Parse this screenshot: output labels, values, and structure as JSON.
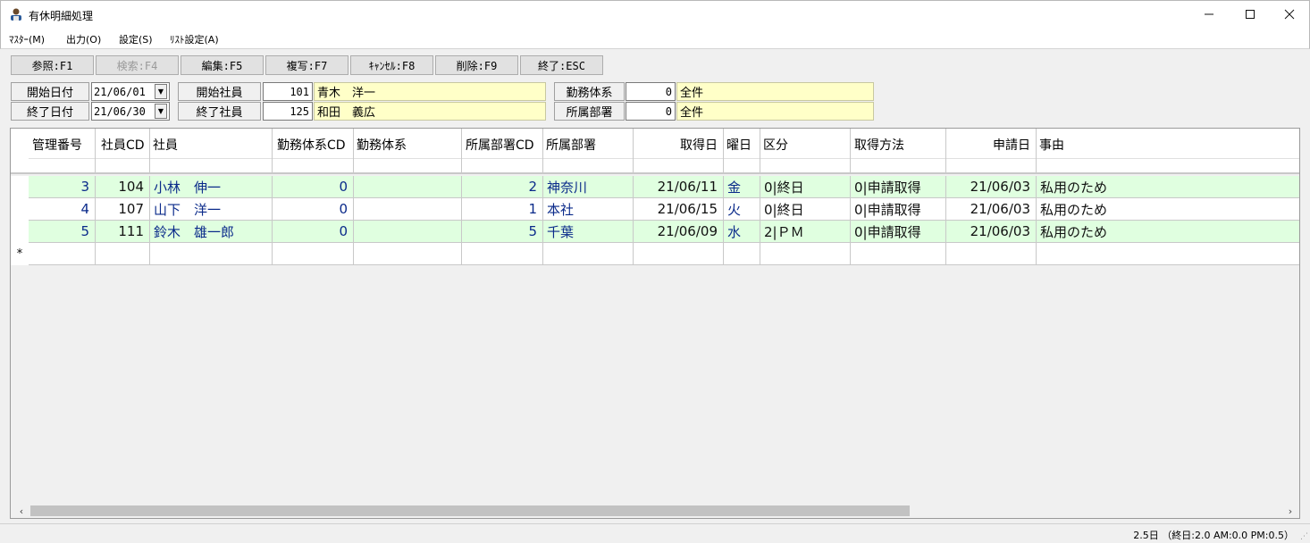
{
  "window": {
    "title": "有休明細処理",
    "minimize": "—",
    "maximize": "☐",
    "close": "✕"
  },
  "menu": [
    "ﾏｽﾀｰ(M)",
    "出力(O)",
    "設定(S)",
    "ﾘｽﾄ設定(A)"
  ],
  "toolbar": [
    {
      "label": "参照:F1",
      "enabled": true
    },
    {
      "label": "検索:F4",
      "enabled": false
    },
    {
      "label": "編集:F5",
      "enabled": true
    },
    {
      "label": "複写:F7",
      "enabled": true
    },
    {
      "label": "ｷｬﾝｾﾙ:F8",
      "enabled": true
    },
    {
      "label": "削除:F9",
      "enabled": true
    },
    {
      "label": "終了:ESC",
      "enabled": true
    }
  ],
  "filters": {
    "start_date_label": "開始日付",
    "start_date": "21/06/01",
    "end_date_label": "終了日付",
    "end_date": "21/06/30",
    "start_emp_label": "開始社員",
    "start_emp_code": "101",
    "start_emp_name": "青木　洋一",
    "end_emp_label": "終了社員",
    "end_emp_code": "125",
    "end_emp_name": "和田　義広",
    "work_label": "勤務体系",
    "work_code": "0",
    "work_name": "全件",
    "dept_label": "所属部署",
    "dept_code": "0",
    "dept_name": "全件"
  },
  "columns": [
    "管理番号",
    "社員CD",
    "社員",
    "勤務体系CD",
    "勤務体系",
    "所属部署CD",
    "所属部署",
    "取得日",
    "曜日",
    "区分",
    "取得方法",
    "申請日",
    "事由"
  ],
  "rows": [
    [
      "3",
      "104",
      "小林　伸一",
      "0",
      "",
      "2",
      "神奈川",
      "21/06/11",
      "金",
      "0|終日",
      "0|申請取得",
      "21/06/03",
      "私用のため"
    ],
    [
      "4",
      "107",
      "山下　洋一",
      "0",
      "",
      "1",
      "本社",
      "21/06/15",
      "火",
      "0|終日",
      "0|申請取得",
      "21/06/03",
      "私用のため"
    ],
    [
      "5",
      "111",
      "鈴木　雄一郎",
      "0",
      "",
      "5",
      "千葉",
      "21/06/09",
      "水",
      "2|ＰＭ",
      "0|申請取得",
      "21/06/03",
      "私用のため"
    ]
  ],
  "new_row_marker": "*",
  "status": "2.5日 （終日:2.0 AM:0.0 PM:0.5）"
}
